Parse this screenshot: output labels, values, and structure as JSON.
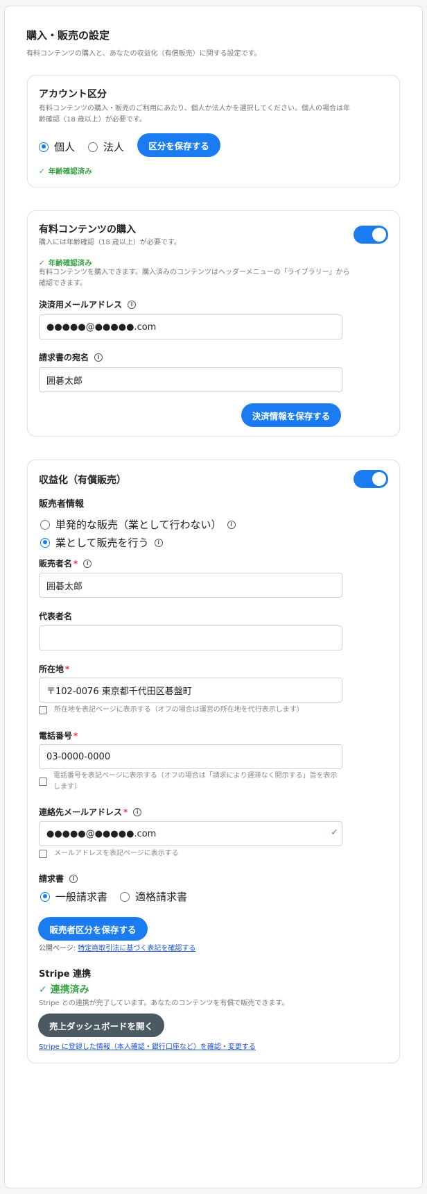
{
  "page": {
    "title": "購入・販売の設定",
    "subtitle": "有料コンテンツの購入と、あなたの収益化（有償販売）に関する設定です。"
  },
  "account": {
    "title": "アカウント区分",
    "desc_line1": "有料コンテンツの購入・販売のご利用にあたり、個人か法人かを選択してください。個人の場合は年",
    "desc_line2": "齢確認（18 歳以上）が必要です。",
    "option_individual": "個人",
    "option_corporate": "法人",
    "selected": "個人",
    "save_label": "区分を保存する",
    "verified": "年齢確認済み"
  },
  "purchase": {
    "title": "有料コンテンツの購入",
    "toggle_on": true,
    "desc": "購入には年齢確認（18 歳以上）が必要です。",
    "verified": "年齢確認済み",
    "info_line1": "有料コンテンツを購入できます。購入済みのコンテンツはヘッダーメニューの「ライブラリー」から",
    "info_line2": "確認できます。",
    "email_label": "決済用メールアドレス",
    "email_value": "●●●●●@●●●●●.com",
    "invoice_name_label": "請求書の宛名",
    "invoice_name_value": "囲碁太郎",
    "save_label": "決済情報を保存する"
  },
  "monetize": {
    "title": "収益化（有償販売）",
    "toggle_on": true,
    "seller_info_title": "販売者情報",
    "option_occasional": "単発的な販売（業として行わない）",
    "option_business": "業として販売を行う",
    "selected": "業として販売を行う",
    "seller_name_label": "販売者名",
    "seller_name_value": "囲碁太郎",
    "representative_label": "代表者名",
    "representative_value": "",
    "address_label": "所在地",
    "address_value": "〒102-0076 東京都千代田区碁盤町",
    "address_checkbox": "所在地を表記ページに表示する（オフの場合は運営の所在地を代行表示します）",
    "phone_label": "電話番号",
    "phone_value": "03-0000-0000",
    "phone_checkbox_line1": "電話番号を表記ページに表示する（オフの場合は「請求により遅滞なく開示する」旨を表示",
    "phone_checkbox_line2": "します）",
    "contact_email_label": "連絡先メールアドレス",
    "contact_email_value": "●●●●●@●●●●●.com",
    "contact_email_checkbox": "メールアドレスを表記ページに表示する",
    "invoice_label": "請求書",
    "invoice_option_general": "一般請求書",
    "invoice_option_qualified": "適格請求書",
    "invoice_selected": "一般請求書",
    "save_label": "販売者区分を保存する",
    "public_page_prefix": "公開ページ: ",
    "public_page_link": "特定商取引法に基づく表記を確認する",
    "stripe_title": "Stripe 連携",
    "stripe_status": "連携済み",
    "stripe_desc": "Stripe との連携が完了しています。あなたのコンテンツを有償で販売できます。",
    "dashboard_label": "売上ダッシュボードを開く",
    "stripe_link": "Stripe に登録した情報（本人確認・銀行口座など）を確認・変更する"
  },
  "colors": {
    "accent": "#1a7cf0",
    "success": "#3aa344",
    "required": "#e03b3b",
    "dark_button": "#4a5962"
  }
}
